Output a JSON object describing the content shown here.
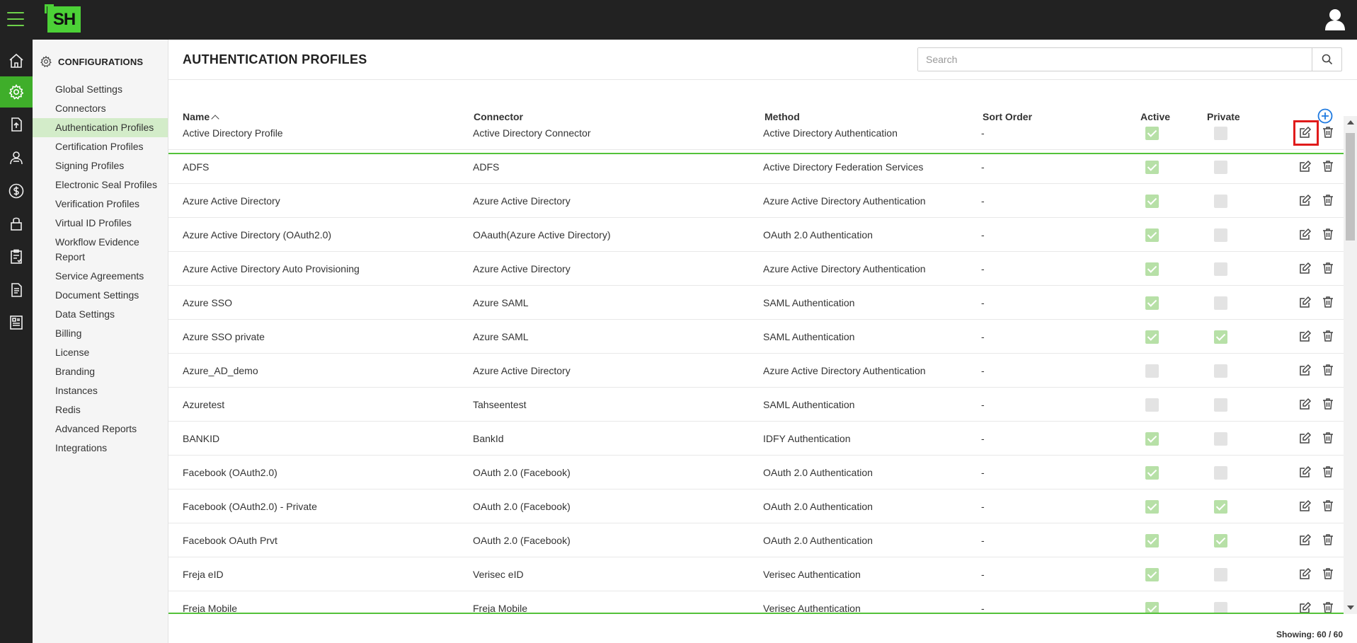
{
  "app": {
    "logo_text": "SH"
  },
  "colors": {
    "accent": "#3fae2a",
    "topbar": "#222222",
    "highlight": "#e01b1b"
  },
  "rail": [
    {
      "icon": "home-icon",
      "active": false
    },
    {
      "icon": "settings-icon",
      "active": true
    },
    {
      "icon": "upload-document-icon",
      "active": false
    },
    {
      "icon": "user-profile-icon",
      "active": false
    },
    {
      "icon": "dollar-icon",
      "active": false
    },
    {
      "icon": "lock-icon",
      "active": false
    },
    {
      "icon": "clipboard-check-icon",
      "active": false
    },
    {
      "icon": "document-icon",
      "active": false
    },
    {
      "icon": "report-icon",
      "active": false
    }
  ],
  "subnav": {
    "title": "CONFIGURATIONS",
    "items": [
      {
        "label": "Global Settings",
        "active": false
      },
      {
        "label": "Connectors",
        "active": false
      },
      {
        "label": "Authentication Profiles",
        "active": true
      },
      {
        "label": "Certification Profiles",
        "active": false
      },
      {
        "label": "Signing Profiles",
        "active": false
      },
      {
        "label": "Electronic Seal Profiles",
        "active": false
      },
      {
        "label": "Verification Profiles",
        "active": false
      },
      {
        "label": "Virtual ID Profiles",
        "active": false
      },
      {
        "label": "Workflow Evidence Report",
        "active": false
      },
      {
        "label": "Service Agreements",
        "active": false
      },
      {
        "label": "Document Settings",
        "active": false
      },
      {
        "label": "Data Settings",
        "active": false
      },
      {
        "label": "Billing",
        "active": false
      },
      {
        "label": "License",
        "active": false
      },
      {
        "label": "Branding",
        "active": false
      },
      {
        "label": "Instances",
        "active": false
      },
      {
        "label": "Redis",
        "active": false
      },
      {
        "label": "Advanced Reports",
        "active": false
      },
      {
        "label": "Integrations",
        "active": false
      }
    ]
  },
  "main": {
    "title": "AUTHENTICATION PROFILES",
    "search_placeholder": "Search",
    "columns": {
      "name": "Name",
      "connector": "Connector",
      "method": "Method",
      "sort_order": "Sort Order",
      "active": "Active",
      "private": "Private"
    },
    "rows": [
      {
        "name": "Active Directory Profile",
        "connector": "Active Directory Connector",
        "method": "Active Directory Authentication",
        "sort_order": "-",
        "active": true,
        "private": false
      },
      {
        "name": "ADFS",
        "connector": "ADFS",
        "method": "Active Directory Federation Services",
        "sort_order": "-",
        "active": true,
        "private": false
      },
      {
        "name": "Azure Active Directory",
        "connector": "Azure Active Directory",
        "method": "Azure Active Directory Authentication",
        "sort_order": "-",
        "active": true,
        "private": false
      },
      {
        "name": "Azure Active Directory (OAuth2.0)",
        "connector": "OAauth(Azure Active Directory)",
        "method": "OAuth 2.0 Authentication",
        "sort_order": "-",
        "active": true,
        "private": false
      },
      {
        "name": "Azure Active Directory Auto Provisioning",
        "connector": "Azure Active Directory",
        "method": "Azure Active Directory Authentication",
        "sort_order": "-",
        "active": true,
        "private": false
      },
      {
        "name": "Azure SSO",
        "connector": "Azure SAML",
        "method": "SAML Authentication",
        "sort_order": "-",
        "active": true,
        "private": false
      },
      {
        "name": "Azure SSO private",
        "connector": "Azure SAML",
        "method": "SAML Authentication",
        "sort_order": "-",
        "active": true,
        "private": true
      },
      {
        "name": "Azure_AD_demo",
        "connector": "Azure Active Directory",
        "method": "Azure Active Directory Authentication",
        "sort_order": "-",
        "active": false,
        "private": false
      },
      {
        "name": "Azuretest",
        "connector": "Tahseentest",
        "method": "SAML Authentication",
        "sort_order": "-",
        "active": false,
        "private": false
      },
      {
        "name": "BANKID",
        "connector": "BankId",
        "method": "IDFY Authentication",
        "sort_order": "-",
        "active": true,
        "private": false
      },
      {
        "name": "Facebook (OAuth2.0)",
        "connector": "OAuth 2.0 (Facebook)",
        "method": "OAuth 2.0 Authentication",
        "sort_order": "-",
        "active": true,
        "private": false
      },
      {
        "name": "Facebook (OAuth2.0) - Private",
        "connector": "OAuth 2.0 (Facebook)",
        "method": "OAuth 2.0 Authentication",
        "sort_order": "-",
        "active": true,
        "private": true
      },
      {
        "name": "Facebook OAuth Prvt",
        "connector": "OAuth 2.0 (Facebook)",
        "method": "OAuth 2.0 Authentication",
        "sort_order": "-",
        "active": true,
        "private": true
      },
      {
        "name": "Freja eID",
        "connector": "Verisec eID",
        "method": "Verisec Authentication",
        "sort_order": "-",
        "active": true,
        "private": false
      },
      {
        "name": "Freja Mobile",
        "connector": "Freja Mobile",
        "method": "Verisec Authentication",
        "sort_order": "-",
        "active": true,
        "private": false
      }
    ],
    "footer": "Showing: 60 / 60"
  }
}
